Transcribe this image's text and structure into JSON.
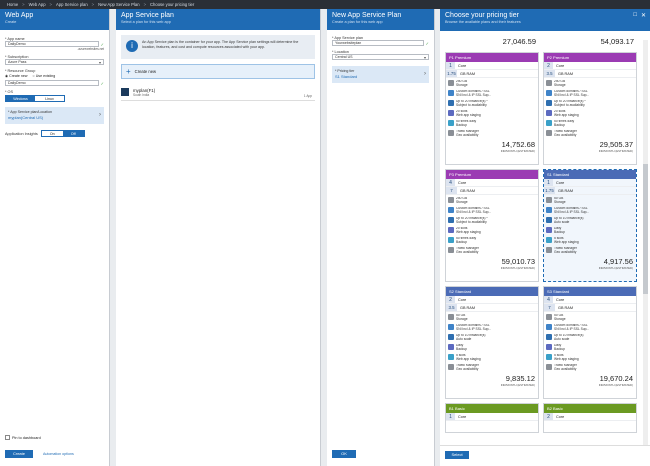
{
  "breadcrumb": [
    "Home",
    "Web App",
    "App Service plan",
    "New App Service Plan",
    "Choose your pricing tier"
  ],
  "blade1": {
    "title": "Web App",
    "subtitle": "Create",
    "app_name_label": "* App name",
    "app_name": "DailyDemo",
    "domain": ".azurewebsites.net",
    "sub_label": "* Subscription",
    "sub_value": "Azure Pass",
    "rg_label": "* Resource Group",
    "rg_create": "Create new",
    "rg_existing": "Use existing",
    "rg_value": "DailyDemo",
    "os_label": "* OS",
    "os_windows": "Windows",
    "os_linux": "Linux",
    "plan_label": "* App Service plan/Location",
    "plan_value": "myplan(Central US)",
    "ai_label": "Application Insights",
    "ai_on": "On",
    "ai_off": "Off",
    "pin": "Pin to dashboard",
    "create": "Create",
    "automation": "Automation options"
  },
  "blade2": {
    "title": "App Service plan",
    "subtitle": "Select a plan for this web app",
    "info": "An App Service plan is the container for your app. The App Service plan settings will determine the location, features, and cost and compute resources associated with your app.",
    "create_new": "Create new",
    "plan_name": "myplan(F1)",
    "plan_loc": "South India",
    "plan_count": "1 App"
  },
  "blade3": {
    "title": "New App Service Plan",
    "subtitle": "Create a plan for this web app",
    "plan_label": "* App Service plan",
    "plan_value": "Yourwebsiteplan",
    "loc_label": "* Location",
    "loc_value": "Central US",
    "tier_label": "* Pricing tier",
    "tier_value": "S1 Standard",
    "ok": "OK"
  },
  "blade4": {
    "title": "Choose your pricing tier",
    "subtitle": "Browse the available plans and their features",
    "select": "Select",
    "top_prices": [
      "27,046.59",
      "54,093.17"
    ],
    "tiles": [
      {
        "code": "P1",
        "tier": "Premium",
        "cores": "1",
        "core_label": "Core",
        "ram": "1.75",
        "ram_label": "GB RAM",
        "storage": "250 GB",
        "storage_label": "Storage",
        "f1": "Custom domains / SSL",
        "f1b": "SNI Incl & IP SSL Sup...",
        "f2": "Up to 20 instance(s) *",
        "f2b": "Subject to availability",
        "f3": "20 slots",
        "f3b": "Web app staging",
        "f4": "50 times daily",
        "f4b": "Backup",
        "f5": "Traffic Manager",
        "f5b": "Geo availability",
        "price": "14,752.68",
        "per": "INR/MONTH (ESTIMATED)",
        "color": "prem"
      },
      {
        "code": "P2",
        "tier": "Premium",
        "cores": "2",
        "core_label": "Core",
        "ram": "3.5",
        "ram_label": "GB RAM",
        "storage": "250 GB",
        "storage_label": "Storage",
        "f1": "Custom domains / SSL",
        "f1b": "SNI Incl & IP SSL Sup...",
        "f2": "Up to 20 instance(s) *",
        "f2b": "Subject to availability",
        "f3": "20 slots",
        "f3b": "Web app staging",
        "f4": "50 times daily",
        "f4b": "Backup",
        "f5": "Traffic Manager",
        "f5b": "Geo availability",
        "price": "29,505.37",
        "per": "INR/MONTH (ESTIMATED)",
        "color": "prem"
      },
      {
        "code": "P3",
        "tier": "Premium",
        "cores": "4",
        "core_label": "Core",
        "ram": "7",
        "ram_label": "GB RAM",
        "storage": "250 GB",
        "storage_label": "Storage",
        "f1": "Custom domains / SSL",
        "f1b": "SNI Incl & IP SSL Sup...",
        "f2": "Up to 20 instance(s) *",
        "f2b": "Subject to availability",
        "f3": "20 slots",
        "f3b": "Web app staging",
        "f4": "50 times daily",
        "f4b": "Backup",
        "f5": "Traffic Manager",
        "f5b": "Geo availability",
        "price": "59,010.73",
        "per": "INR/MONTH (ESTIMATED)",
        "color": "prem"
      },
      {
        "code": "S1",
        "tier": "Standard",
        "cores": "1",
        "core_label": "Core",
        "ram": "1.75",
        "ram_label": "GB RAM",
        "storage": "50 GB",
        "storage_label": "Storage",
        "f1": "Custom domains / SSL",
        "f1b": "SNI Incl & IP SSL Sup...",
        "f2": "Up to 10 instance(s)",
        "f2b": "Auto scale",
        "f3": "Daily",
        "f3b": "Backup",
        "f4": "5 slots",
        "f4b": "Web app staging",
        "f5": "Traffic Manager",
        "f5b": "Geo availability",
        "price": "4,917.56",
        "per": "INR/MONTH (ESTIMATED)",
        "color": "std"
      },
      {
        "code": "S2",
        "tier": "Standard",
        "cores": "2",
        "core_label": "Core",
        "ram": "3.5",
        "ram_label": "GB RAM",
        "storage": "50 GB",
        "storage_label": "Storage",
        "f1": "Custom domains / SSL",
        "f1b": "SNI Incl & IP SSL Sup...",
        "f2": "Up to 10 instance(s)",
        "f2b": "Auto scale",
        "f3": "Daily",
        "f3b": "Backup",
        "f4": "5 slots",
        "f4b": "Web app staging",
        "f5": "Traffic Manager",
        "f5b": "Geo availability",
        "price": "9,835.12",
        "per": "INR/MONTH (ESTIMATED)",
        "color": "std"
      },
      {
        "code": "S3",
        "tier": "Standard",
        "cores": "4",
        "core_label": "Core",
        "ram": "7",
        "ram_label": "GB RAM",
        "storage": "50 GB",
        "storage_label": "Storage",
        "f1": "Custom domains / SSL",
        "f1b": "SNI Incl & IP SSL Sup...",
        "f2": "Up to 10 instance(s)",
        "f2b": "Auto scale",
        "f3": "Daily",
        "f3b": "Backup",
        "f4": "5 slots",
        "f4b": "Web app staging",
        "f5": "Traffic Manager",
        "f5b": "Geo availability",
        "price": "19,670.24",
        "per": "INR/MONTH (ESTIMATED)",
        "color": "std"
      }
    ],
    "basic": [
      {
        "code": "B1",
        "tier": "Basic",
        "cores": "1",
        "core_label": "Core"
      },
      {
        "code": "B2",
        "tier": "Basic",
        "cores": "2",
        "core_label": "Core"
      }
    ]
  }
}
